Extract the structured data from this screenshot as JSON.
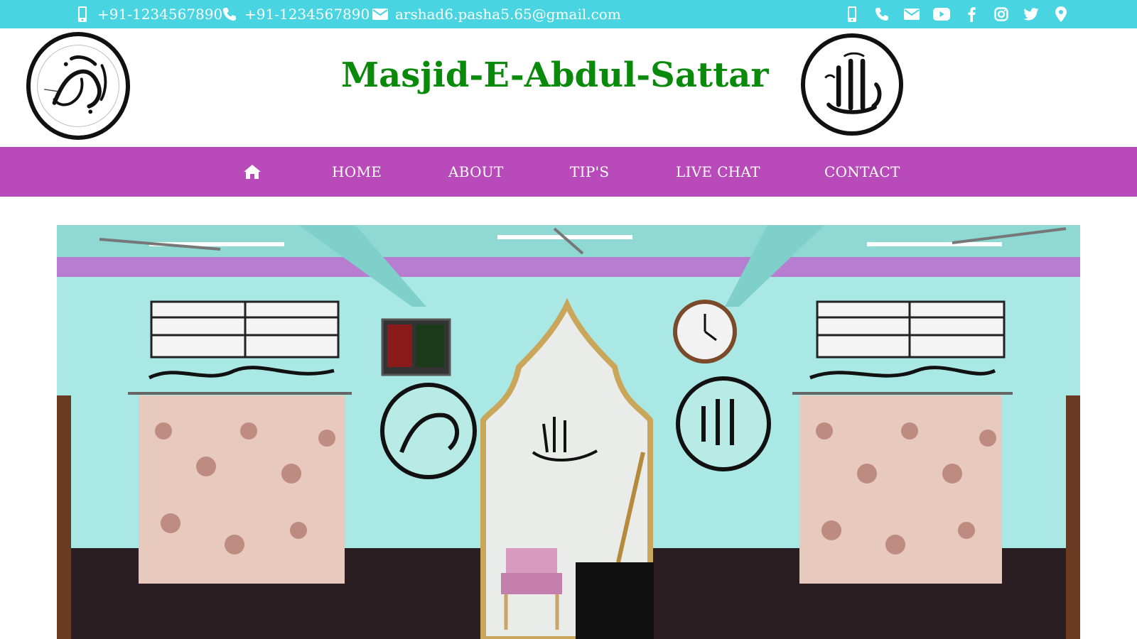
{
  "topbar": {
    "phone1": "+91-1234567890",
    "phone2": "+91-1234567890",
    "email": "arshad6.pasha5.65@gmail.com",
    "icons": [
      "mobile-icon",
      "phone-icon",
      "envelope-icon"
    ],
    "social": [
      "mobile-icon",
      "phone-icon",
      "envelope-icon",
      "youtube-icon",
      "facebook-icon",
      "instagram-icon",
      "twitter-icon",
      "map-marker-icon"
    ],
    "bg": "#48d4e1"
  },
  "header": {
    "title": "Masjid-E-Abdul-Sattar",
    "title_color": "#0a8a0a",
    "left_emblem": "muhammad-calligraphy-emblem",
    "right_emblem": "allah-calligraphy-emblem"
  },
  "nav": {
    "bg": "#b84ab9",
    "home_icon": "home-icon",
    "items": [
      "HOME",
      "ABOUT",
      "TIP'S",
      "LIVE CHAT",
      "CONTACT"
    ]
  },
  "hero": {
    "image": "mosque-interior-photo"
  }
}
